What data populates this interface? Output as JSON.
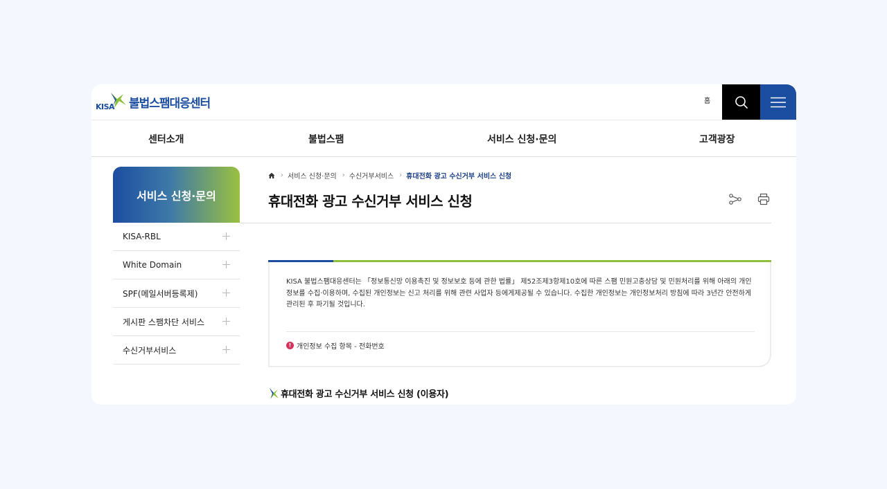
{
  "header": {
    "logo_kisa": "KISA",
    "logo_title": "불법스팸대응센터",
    "home_label": "홈"
  },
  "gnb": {
    "items": [
      {
        "label": "센터소개"
      },
      {
        "label": "불법스팸"
      },
      {
        "label": "서비스 신청·문의"
      },
      {
        "label": "고객광장"
      }
    ]
  },
  "side_nav": {
    "title": "서비스 신청·문의",
    "items": [
      {
        "label": "KISA-RBL"
      },
      {
        "label": "White Domain"
      },
      {
        "label": "SPF(메일서버등록제)"
      },
      {
        "label": "게시판 스팸차단 서비스"
      },
      {
        "label": "수신거부서비스"
      }
    ]
  },
  "breadcrumb": {
    "items": [
      {
        "label": "서비스 신청·문의"
      },
      {
        "label": "수신거부서비스"
      }
    ],
    "current": "휴대전화 광고 수신거부 서비스 신청"
  },
  "page": {
    "title": "휴대전화 광고 수신거부 서비스 신청"
  },
  "info": {
    "text": "KISA 불법스팸대응센터는 「정보통신망 이용촉진 및 정보보호 등에 관한 법률」 제52조제3항제10호에 따른 스팸 민원고충상담 및 민원처리를 위해 아래의 개인정보를 수집·이용하며, 수집된 개인정보는 신고 처리를 위해 관련 사업자 등에게제공될 수 있습니다. 수집한 개인정보는 개인정보처리 방침에 따라 3년간 안전하게 관리된 후 파기될 것입니다.",
    "notice": "개인정보 수집 항목 - 전화번호",
    "notice_icon": "!"
  },
  "section": {
    "title": "휴대전화 광고 수신거부 서비스 신청 (이용자)"
  },
  "colors": {
    "brand_blue": "#1b4ea0",
    "brand_green": "#8cc03b",
    "alert_red": "#d6335a"
  }
}
